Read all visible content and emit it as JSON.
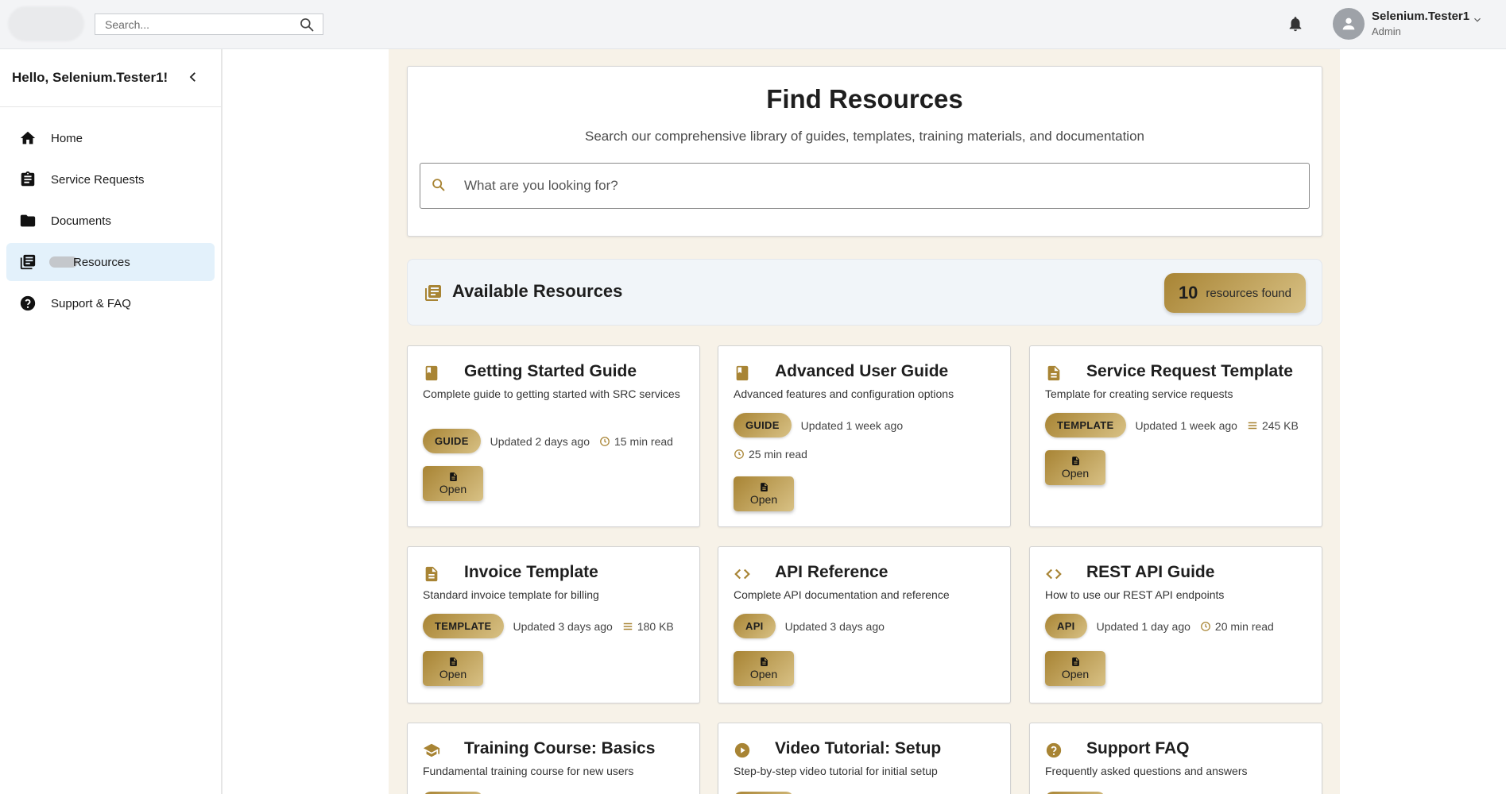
{
  "colors": {
    "accent_dark": "#a88434",
    "accent_light": "#d8c185",
    "active_nav": "#e3f1fb",
    "content_bg": "#f7f2e8"
  },
  "topbar": {
    "search_placeholder": "Search...",
    "user_name": "Selenium.Tester1",
    "user_role": "Admin"
  },
  "sidebar": {
    "greeting": "Hello, Selenium.Tester1!",
    "items": [
      {
        "label": "Home",
        "icon": "home-icon"
      },
      {
        "label": "Service Requests",
        "icon": "clipboard-icon"
      },
      {
        "label": "Documents",
        "icon": "folder-icon"
      },
      {
        "label": "Resources",
        "icon": "library-icon",
        "active": true
      },
      {
        "label": "Support & FAQ",
        "icon": "help-icon"
      }
    ]
  },
  "hero": {
    "title": "Find Resources",
    "subtitle": "Search our comprehensive library of guides, templates, training materials, and documentation",
    "search_placeholder": "What are you looking for?"
  },
  "available": {
    "title": "Available Resources",
    "count": "10",
    "count_label": "resources found"
  },
  "cards": [
    {
      "title": "Getting Started Guide",
      "description": "Complete guide to getting started with SRC services",
      "badge": "GUIDE",
      "updated": "Updated 2 days ago",
      "extra": "15 min read",
      "extra_icon": "clock-icon",
      "icon": "book-icon",
      "button": "Open"
    },
    {
      "title": "Advanced User Guide",
      "description": "Advanced features and configuration options",
      "badge": "GUIDE",
      "updated": "Updated 1 week ago",
      "extra": "25 min read",
      "extra_icon": "clock-icon",
      "icon": "book-icon",
      "button": "Open"
    },
    {
      "title": "Service Request Template",
      "description": "Template for creating service requests",
      "badge": "TEMPLATE",
      "updated": "Updated 1 week ago",
      "extra": "245 KB",
      "extra_icon": "size-icon",
      "icon": "document-icon",
      "button": "Open"
    },
    {
      "title": "Invoice Template",
      "description": "Standard invoice template for billing",
      "badge": "TEMPLATE",
      "updated": "Updated 3 days ago",
      "extra": "180 KB",
      "extra_icon": "size-icon",
      "icon": "document-icon",
      "button": "Open"
    },
    {
      "title": "API Reference",
      "description": "Complete API documentation and reference",
      "badge": "API",
      "updated": "Updated 3 days ago",
      "icon": "code-icon",
      "button": "Open"
    },
    {
      "title": "REST API Guide",
      "description": "How to use our REST API endpoints",
      "badge": "API",
      "updated": "Updated 1 day ago",
      "extra": "20 min read",
      "extra_icon": "clock-icon",
      "icon": "code-icon",
      "button": "Open"
    },
    {
      "title": "Training Course: Basics",
      "description": "Fundamental training course for new users",
      "icon": "graduation-cap-icon"
    },
    {
      "title": "Video Tutorial: Setup",
      "description": "Step-by-step video tutorial for initial setup",
      "icon": "play-circle-icon"
    },
    {
      "title": "Support FAQ",
      "description": "Frequently asked questions and answers",
      "icon": "help-icon"
    }
  ]
}
